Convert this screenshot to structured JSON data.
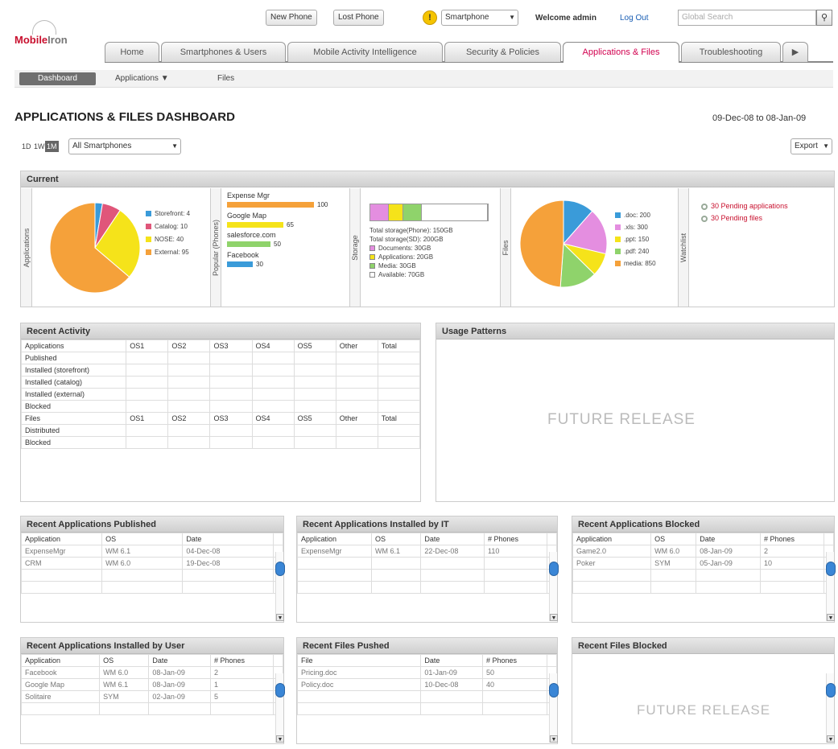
{
  "header": {
    "logo_text_a": "Mobile",
    "logo_text_b": "Iron",
    "new_phone": "New Phone",
    "lost_phone": "Lost Phone",
    "alert_icon": "warning-icon",
    "device_select": "Smartphone",
    "welcome": "Welcome admin",
    "logout": "Log Out",
    "search_placeholder": "Global Search"
  },
  "tabs": [
    {
      "label": "Home"
    },
    {
      "label": "Smartphones & Users"
    },
    {
      "label": "Mobile Activity Intelligence"
    },
    {
      "label": "Security & Policies"
    },
    {
      "label": "Applications & Files"
    },
    {
      "label": "Troubleshooting"
    },
    {
      "label": "▶"
    }
  ],
  "subnav": {
    "dashboard": "Dashboard",
    "applications": "Applications ▼",
    "files": "Files"
  },
  "page": {
    "title": "APPLICATIONS & FILES DASHBOARD",
    "date_range": "09-Dec-08 to 08-Jan-09",
    "range": [
      "1D",
      "1W",
      "1M"
    ],
    "filter": "All Smartphones",
    "export": "Export"
  },
  "current": {
    "title": "Current",
    "applications_label": "Applications",
    "applications_legend": [
      {
        "label": "Storefront: 4",
        "value": 4,
        "color": "#3a9bd9"
      },
      {
        "label": "Catalog: 10",
        "value": 10,
        "color": "#e0567a"
      },
      {
        "label": "NOSE: 40",
        "value": 40,
        "color": "#f5e31a"
      },
      {
        "label": "External: 95",
        "value": 95,
        "color": "#f5a13a"
      }
    ],
    "popular_label": "Popular (Phones)",
    "popular": [
      {
        "name": "Expense Mgr",
        "value": 100,
        "color": "#f5a13a"
      },
      {
        "name": "Google Map",
        "value": 65,
        "color": "#f5e31a"
      },
      {
        "name": "salesforce.com",
        "value": 50,
        "color": "#8fd36b"
      },
      {
        "name": "Facebook",
        "value": 30,
        "color": "#3a9bd9"
      }
    ],
    "storage_label": "Storage",
    "storage_bar": [
      {
        "color": "#e48ee0",
        "value": 20
      },
      {
        "color": "#f5e31a",
        "value": 15
      },
      {
        "color": "#8fd36b",
        "value": 20
      },
      {
        "color": "#ffffff",
        "value": 73
      }
    ],
    "storage_lines": [
      {
        "text": "Total storage(Phone): 150GB",
        "color": ""
      },
      {
        "text": "Total storage(SD): 200GB",
        "color": ""
      },
      {
        "text": "Documents: 30GB",
        "color": "#e48ee0"
      },
      {
        "text": "Applications: 20GB",
        "color": "#f5e31a"
      },
      {
        "text": "Media: 30GB",
        "color": "#8fd36b"
      },
      {
        "text": "Available: 70GB",
        "color": "#ffffff"
      }
    ],
    "files_label": "Files",
    "files_legend": [
      {
        "label": ".doc: 200",
        "value": 200,
        "color": "#3a9bd9"
      },
      {
        "label": ".xls: 300",
        "value": 300,
        "color": "#e48ee0"
      },
      {
        "label": ".ppt: 150",
        "value": 150,
        "color": "#f5e31a"
      },
      {
        "label": ".pdf: 240",
        "value": 240,
        "color": "#8fd36b"
      },
      {
        "label": "media: 850",
        "value": 850,
        "color": "#f5a13a"
      }
    ],
    "watchlist_label": "Watchlist",
    "watchlist": [
      "30 Pending applications",
      "30 Pending files"
    ]
  },
  "recent_activity": {
    "title": "Recent Activity",
    "app_header": [
      "Applications",
      "OS1",
      "OS2",
      "OS3",
      "OS4",
      "OS5",
      "Other",
      "Total"
    ],
    "app_rows": [
      "Published",
      "Installed (storefront)",
      "Installed (catalog)",
      "Installed (external)",
      "Blocked"
    ],
    "files_header": [
      "Files",
      "OS1",
      "OS2",
      "OS3",
      "OS4",
      "OS5",
      "Other",
      "Total"
    ],
    "files_rows": [
      "Distributed",
      "Blocked"
    ]
  },
  "usage": {
    "title": "Usage Patterns",
    "future": "FUTURE RELEASE"
  },
  "published": {
    "title": "Recent Applications Published",
    "header": [
      "Application",
      "OS",
      "Date"
    ],
    "rows": [
      [
        "ExpenseMgr",
        "WM 6.1",
        "04-Dec-08"
      ],
      [
        "CRM",
        "WM 6.0",
        "19-Dec-08"
      ]
    ]
  },
  "installed_it": {
    "title": "Recent Applications Installed by IT",
    "header": [
      "Application",
      "OS",
      "Date",
      "# Phones"
    ],
    "rows": [
      [
        "ExpenseMgr",
        "WM 6.1",
        "22-Dec-08",
        "110"
      ]
    ]
  },
  "blocked_apps": {
    "title": "Recent Applications Blocked",
    "header": [
      "Application",
      "OS",
      "Date",
      "# Phones"
    ],
    "rows": [
      [
        "Game2.0",
        "WM 6.0",
        "08-Jan-09",
        "2"
      ],
      [
        "Poker",
        "SYM",
        "05-Jan-09",
        "10"
      ]
    ]
  },
  "installed_user": {
    "title": "Recent Applications Installed by User",
    "header": [
      "Application",
      "OS",
      "Date",
      "# Phones"
    ],
    "rows": [
      [
        "Facebook",
        "WM 6.0",
        "08-Jan-09",
        "2"
      ],
      [
        "Google Map",
        "WM 6.1",
        "08-Jan-09",
        "1"
      ],
      [
        "Solitaire",
        "SYM",
        "02-Jan-09",
        "5"
      ]
    ]
  },
  "files_pushed": {
    "title": "Recent Files Pushed",
    "header": [
      "File",
      "Date",
      "# Phones"
    ],
    "rows": [
      [
        "Pricing.doc",
        "01-Jan-09",
        "50"
      ],
      [
        "Policy.doc",
        "10-Dec-08",
        "40"
      ]
    ]
  },
  "files_blocked": {
    "title": "Recent Files Blocked",
    "future": "FUTURE RELEASE"
  },
  "scroll_icons": {
    "thumb": "scroll-thumb-icon",
    "down": "scroll-down-icon"
  }
}
